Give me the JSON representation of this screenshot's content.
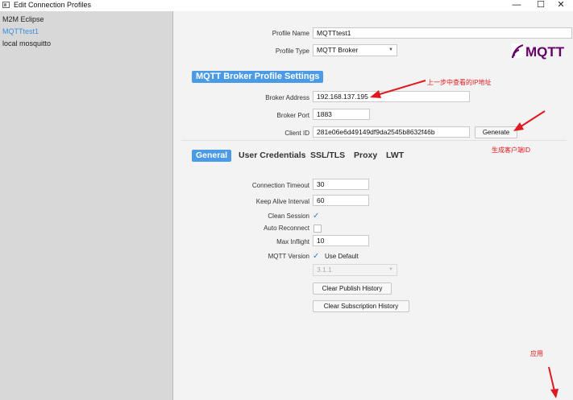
{
  "window": {
    "title": "Edit Connection Profiles"
  },
  "sidebar": {
    "items": [
      {
        "label": "M2M Eclipse"
      },
      {
        "label": "MQTTtest1"
      },
      {
        "label": "local mosquitto"
      }
    ]
  },
  "profile": {
    "name_label": "Profile Name",
    "name_value": "MQTTtest1",
    "type_label": "Profile Type",
    "type_value": "MQTT Broker",
    "logo_text": "MQTT"
  },
  "broker": {
    "section_title": "MQTT Broker Profile Settings",
    "address_label": "Broker Address",
    "address_value": "192.168.137.195",
    "port_label": "Broker Port",
    "port_value": "1883",
    "client_label": "Client ID",
    "client_value": "281e06e6d49149df9da2545b8632f46b",
    "generate_label": "Generate"
  },
  "tabs": [
    "General",
    "User Credentials",
    "SSL/TLS",
    "Proxy",
    "LWT"
  ],
  "general": {
    "timeout_label": "Connection Timeout",
    "timeout_value": "30",
    "keepalive_label": "Keep Alive Interval",
    "keepalive_value": "60",
    "clean_label": "Clean Session",
    "clean_checked": true,
    "auto_label": "Auto Reconnect",
    "auto_checked": false,
    "inflight_label": "Max Inflight",
    "inflight_value": "10",
    "version_label": "MQTT Version",
    "use_default_label": "Use Default",
    "version_select": "3.1.1",
    "clear_publish": "Clear Publish History",
    "clear_subscription": "Clear Subscription History"
  },
  "annotations": {
    "ip_note": "上一步中查看的IP地址",
    "client_note": "生成客户端ID",
    "apply_note": "应用",
    "color": "#e0191e"
  }
}
